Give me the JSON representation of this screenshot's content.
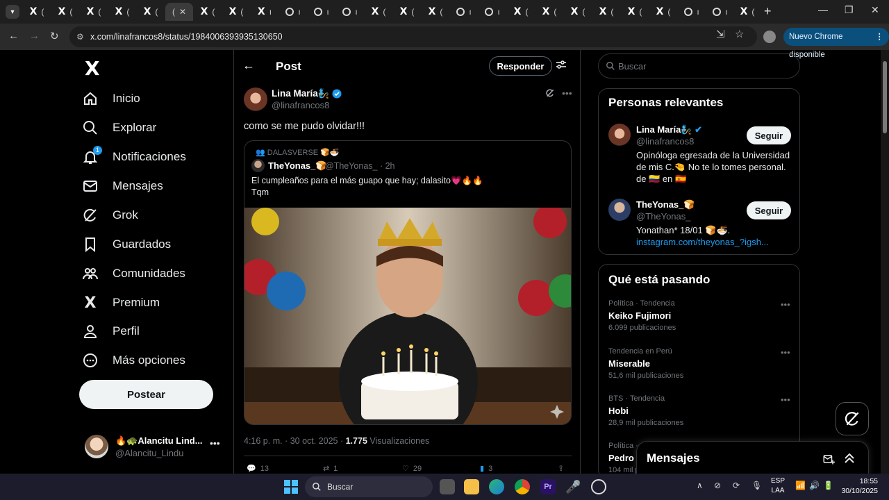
{
  "browser": {
    "active_tab_title": "(",
    "url": "x.com/linafrancos8/status/1984006393935130650",
    "update_label": "Nuevo Chrome disponible"
  },
  "nav": {
    "items": [
      {
        "label": "Inicio",
        "icon": "home-icon"
      },
      {
        "label": "Explorar",
        "icon": "search-icon"
      },
      {
        "label": "Notificaciones",
        "icon": "bell-icon",
        "badge": "1"
      },
      {
        "label": "Mensajes",
        "icon": "mail-icon"
      },
      {
        "label": "Grok",
        "icon": "grok-icon"
      },
      {
        "label": "Guardados",
        "icon": "bookmark-icon"
      },
      {
        "label": "Comunidades",
        "icon": "communities-icon"
      },
      {
        "label": "Premium",
        "icon": "x-icon"
      },
      {
        "label": "Perfil",
        "icon": "person-icon"
      },
      {
        "label": "Más opciones",
        "icon": "more-circle-icon"
      }
    ],
    "post_button": "Postear",
    "account": {
      "name": "🔥🐢Alancitu Lind...",
      "handle": "@Alancitu_Lindu"
    }
  },
  "header": {
    "title": "Post",
    "reply_button": "Responder"
  },
  "post": {
    "author_name": "Lina María🧞",
    "author_handle": "@linafrancos8",
    "text": "como se me pudo olvidar!!!",
    "quote": {
      "community": "DALASVERSE 🍞🍜",
      "author_name": "TheYonas_🍞",
      "author_handle": "@TheYonas_",
      "time": "· 2h",
      "text_line1": "El cumpleaños para el más guapo que hay; dalasito💗🔥🔥",
      "text_line2": "Tqm"
    },
    "timestamp": "4:16 p. m. · 30 oct. 2025 · ",
    "views_count": "1.775",
    "views_label": " Visualizaciones",
    "replies": "13",
    "reposts": "1",
    "likes": "29",
    "bookmarks": "3"
  },
  "sidebar": {
    "search_placeholder": "Buscar",
    "relevant_title": "Personas relevantes",
    "people": [
      {
        "name": "Lina María🧞",
        "handle": "@linafrancos8",
        "bio": "Opinóloga egresada de la Universidad de mis C.🤏 No te lo tomes personal. de 🇨🇴 en 🇪🇸",
        "follow": "Seguir"
      },
      {
        "name": "TheYonas_🍞",
        "handle": "@TheYonas_",
        "bio": "Yonathan* 18/01 🍞🍜.",
        "link": "instagram.com/theyonas_?igsh...",
        "follow": "Seguir"
      }
    ],
    "trends_title": "Qué está pasando",
    "trends": [
      {
        "category": "Política · Tendencia",
        "name": "Keiko Fujimori",
        "count": "6.099 publicaciones"
      },
      {
        "category": "Tendencia en Perú",
        "name": "Miserable",
        "count": "51,6 mil publicaciones"
      },
      {
        "category": "BTS · Tendencia",
        "name": "Hobi",
        "count": "28,9 mil publicaciones"
      },
      {
        "category": "Política · ",
        "name": "Pedro S",
        "count": "104 mil p"
      }
    ]
  },
  "messages_drawer": {
    "title": "Mensajes"
  },
  "taskbar": {
    "search": "Buscar",
    "lang": "ESP",
    "region": "LAA",
    "time": "18:55",
    "date": "30/10/2025"
  }
}
